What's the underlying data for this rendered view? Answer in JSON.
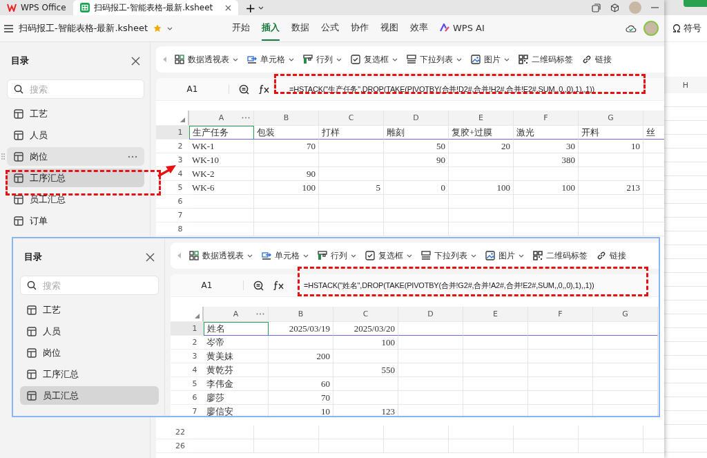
{
  "tabs": [
    {
      "label": "WPS Office",
      "selected": false,
      "kind": "home"
    },
    {
      "label": "扫码报工-智能表格-最新.ksheet",
      "selected": true,
      "kind": "sheet"
    }
  ],
  "new_tab": "+",
  "doc_title": "扫码报工-智能表格-最新.ksheet",
  "menu": [
    {
      "label": "开始",
      "selected": false
    },
    {
      "label": "插入",
      "selected": true
    },
    {
      "label": "数据",
      "selected": false
    },
    {
      "label": "公式",
      "selected": false
    },
    {
      "label": "协作",
      "selected": false
    },
    {
      "label": "视图",
      "selected": false
    },
    {
      "label": "效率",
      "selected": false
    },
    {
      "label": "WPS AI",
      "selected": false,
      "kind": "ai"
    }
  ],
  "main": {
    "sidebar": {
      "title": "目录",
      "search_placeholder": "搜索",
      "items": [
        {
          "label": "工艺",
          "selected": false,
          "hovered": false
        },
        {
          "label": "人员",
          "selected": false,
          "hovered": false
        },
        {
          "label": "岗位",
          "selected": false,
          "hovered": true
        },
        {
          "label": "工序汇总",
          "selected": true,
          "hovered": false
        },
        {
          "label": "员工汇总",
          "selected": false,
          "hovered": false
        },
        {
          "label": "订单",
          "selected": false,
          "hovered": false
        }
      ]
    },
    "toolbar": [
      {
        "label": "数据透视表",
        "kind": "pivot",
        "dropdown": true
      },
      {
        "label": "单元格",
        "kind": "cell",
        "dropdown": true
      },
      {
        "label": "行列",
        "kind": "rowcol",
        "dropdown": true
      },
      {
        "label": "复选框",
        "kind": "checkbox",
        "dropdown": true
      },
      {
        "label": "下拉列表",
        "kind": "list",
        "dropdown": true
      },
      {
        "label": "图片",
        "kind": "picture",
        "dropdown": true
      },
      {
        "label": "二维码标签",
        "kind": "qrcode",
        "dropdown": false
      },
      {
        "label": "链接",
        "kind": "link",
        "dropdown": false
      }
    ],
    "cell_ref": "A1",
    "formula": "=HSTACK(\"生产任务\",DROP(TAKE(PIVOTBY(合并!D2#,合并!H2#,合并!E2#,SUM,,0,,0),1),,1))",
    "columns": [
      "A",
      "B",
      "C",
      "D",
      "E",
      "F",
      "G"
    ],
    "rows": [
      {
        "num": "1",
        "kind": "text",
        "spill": true,
        "cells": [
          "生产任务",
          "包装",
          "打样",
          "雕刻",
          "复胶+过膜",
          "激光",
          "开料",
          "丝"
        ]
      },
      {
        "num": "2",
        "kind": "data",
        "spill": false,
        "cells": [
          "WK-1",
          "70",
          null,
          "50",
          "20",
          "30",
          "10"
        ]
      },
      {
        "num": "3",
        "kind": "data",
        "spill": false,
        "cells": [
          "WK-10",
          null,
          null,
          "90",
          null,
          "380"
        ]
      },
      {
        "num": "4",
        "kind": "data",
        "spill": false,
        "cells": [
          "WK-2",
          "90"
        ]
      },
      {
        "num": "5",
        "kind": "data",
        "spill": false,
        "cells": [
          "WK-6",
          "100",
          "5",
          "0",
          "100",
          "100",
          "213"
        ]
      },
      {
        "num": "6",
        "kind": "data",
        "spill": false,
        "cells": []
      },
      {
        "num": "7",
        "kind": "data",
        "spill": false,
        "cells": []
      },
      {
        "num": "8",
        "kind": "data",
        "spill": false,
        "cells": []
      }
    ],
    "lower_rows": [
      "22",
      "26"
    ]
  },
  "inset": {
    "sidebar": {
      "title": "目录",
      "search_placeholder": "搜索",
      "items": [
        {
          "label": "工艺",
          "selected": false,
          "hovered": false
        },
        {
          "label": "人员",
          "selected": false,
          "hovered": false
        },
        {
          "label": "岗位",
          "selected": false,
          "hovered": false
        },
        {
          "label": "工序汇总",
          "selected": false,
          "hovered": false
        },
        {
          "label": "员工汇总",
          "selected": true,
          "hovered": false
        }
      ]
    },
    "toolbar": [
      {
        "label": "数据透视表",
        "kind": "pivot",
        "dropdown": true
      },
      {
        "label": "单元格",
        "kind": "cell",
        "dropdown": true
      },
      {
        "label": "行列",
        "kind": "rowcol",
        "dropdown": true
      },
      {
        "label": "复选框",
        "kind": "checkbox",
        "dropdown": true
      },
      {
        "label": "下拉列表",
        "kind": "list",
        "dropdown": true
      },
      {
        "label": "图片",
        "kind": "picture",
        "dropdown": true
      },
      {
        "label": "二维码标签",
        "kind": "qrcode",
        "dropdown": false
      },
      {
        "label": "链接",
        "kind": "link",
        "dropdown": false
      }
    ],
    "cell_ref": "A1",
    "formula": "=HSTACK(\"姓名\",DROP(TAKE(PIVOTBY(合并!G2#,合并!A2#,合并!E2#,SUM,,0,,0),1),,1))",
    "columns": [
      "A",
      "B",
      "C",
      "D",
      "E",
      "F",
      "G"
    ],
    "rows": [
      {
        "num": "1",
        "kind": "data",
        "spill": true,
        "cells": [
          "姓名",
          "2025/03/19",
          "2025/03/20"
        ]
      },
      {
        "num": "2",
        "kind": "data",
        "spill": false,
        "cells": [
          "岑帝",
          null,
          "100"
        ]
      },
      {
        "num": "3",
        "kind": "data",
        "spill": false,
        "cells": [
          "黄美妹",
          "200"
        ]
      },
      {
        "num": "4",
        "kind": "data",
        "spill": false,
        "cells": [
          "黄乾芬",
          null,
          "550"
        ]
      },
      {
        "num": "5",
        "kind": "data",
        "spill": false,
        "cells": [
          "李伟金",
          "60"
        ]
      },
      {
        "num": "6",
        "kind": "data",
        "spill": false,
        "cells": [
          "廖莎",
          "70"
        ]
      },
      {
        "num": "7",
        "kind": "data",
        "spill": false,
        "cells": [
          "廖信安",
          "10",
          "123"
        ]
      }
    ]
  },
  "side_window": {
    "ribbon_label": "符号",
    "column": "H"
  }
}
